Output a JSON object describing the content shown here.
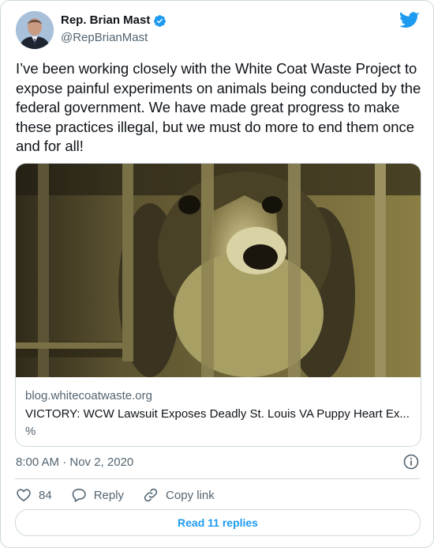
{
  "author": {
    "name": "Rep. Brian Mast",
    "handle": "@RepBrianMast",
    "verified": true
  },
  "tweet": {
    "text": "I’ve been working closely with the White Coat Waste Project to expose painful experiments on animals being conducted by the federal government. We have made great progress to make these practices illegal, but we must do more to end them once and for all!"
  },
  "link_card": {
    "domain": "blog.whitecoatwaste.org",
    "title": "VICTORY: WCW Lawsuit Exposes Deadly St. Louis VA Puppy Heart Ex...",
    "description": "%"
  },
  "meta": {
    "timestamp": "8:00 AM · Nov 2, 2020"
  },
  "actions": {
    "like_count": "84",
    "reply_label": "Reply",
    "copy_label": "Copy link"
  },
  "footer": {
    "read_replies_label": "Read 11 replies"
  },
  "colors": {
    "accent": "#1d9bf0",
    "secondary_text": "#536471",
    "border": "#cfd9de"
  }
}
